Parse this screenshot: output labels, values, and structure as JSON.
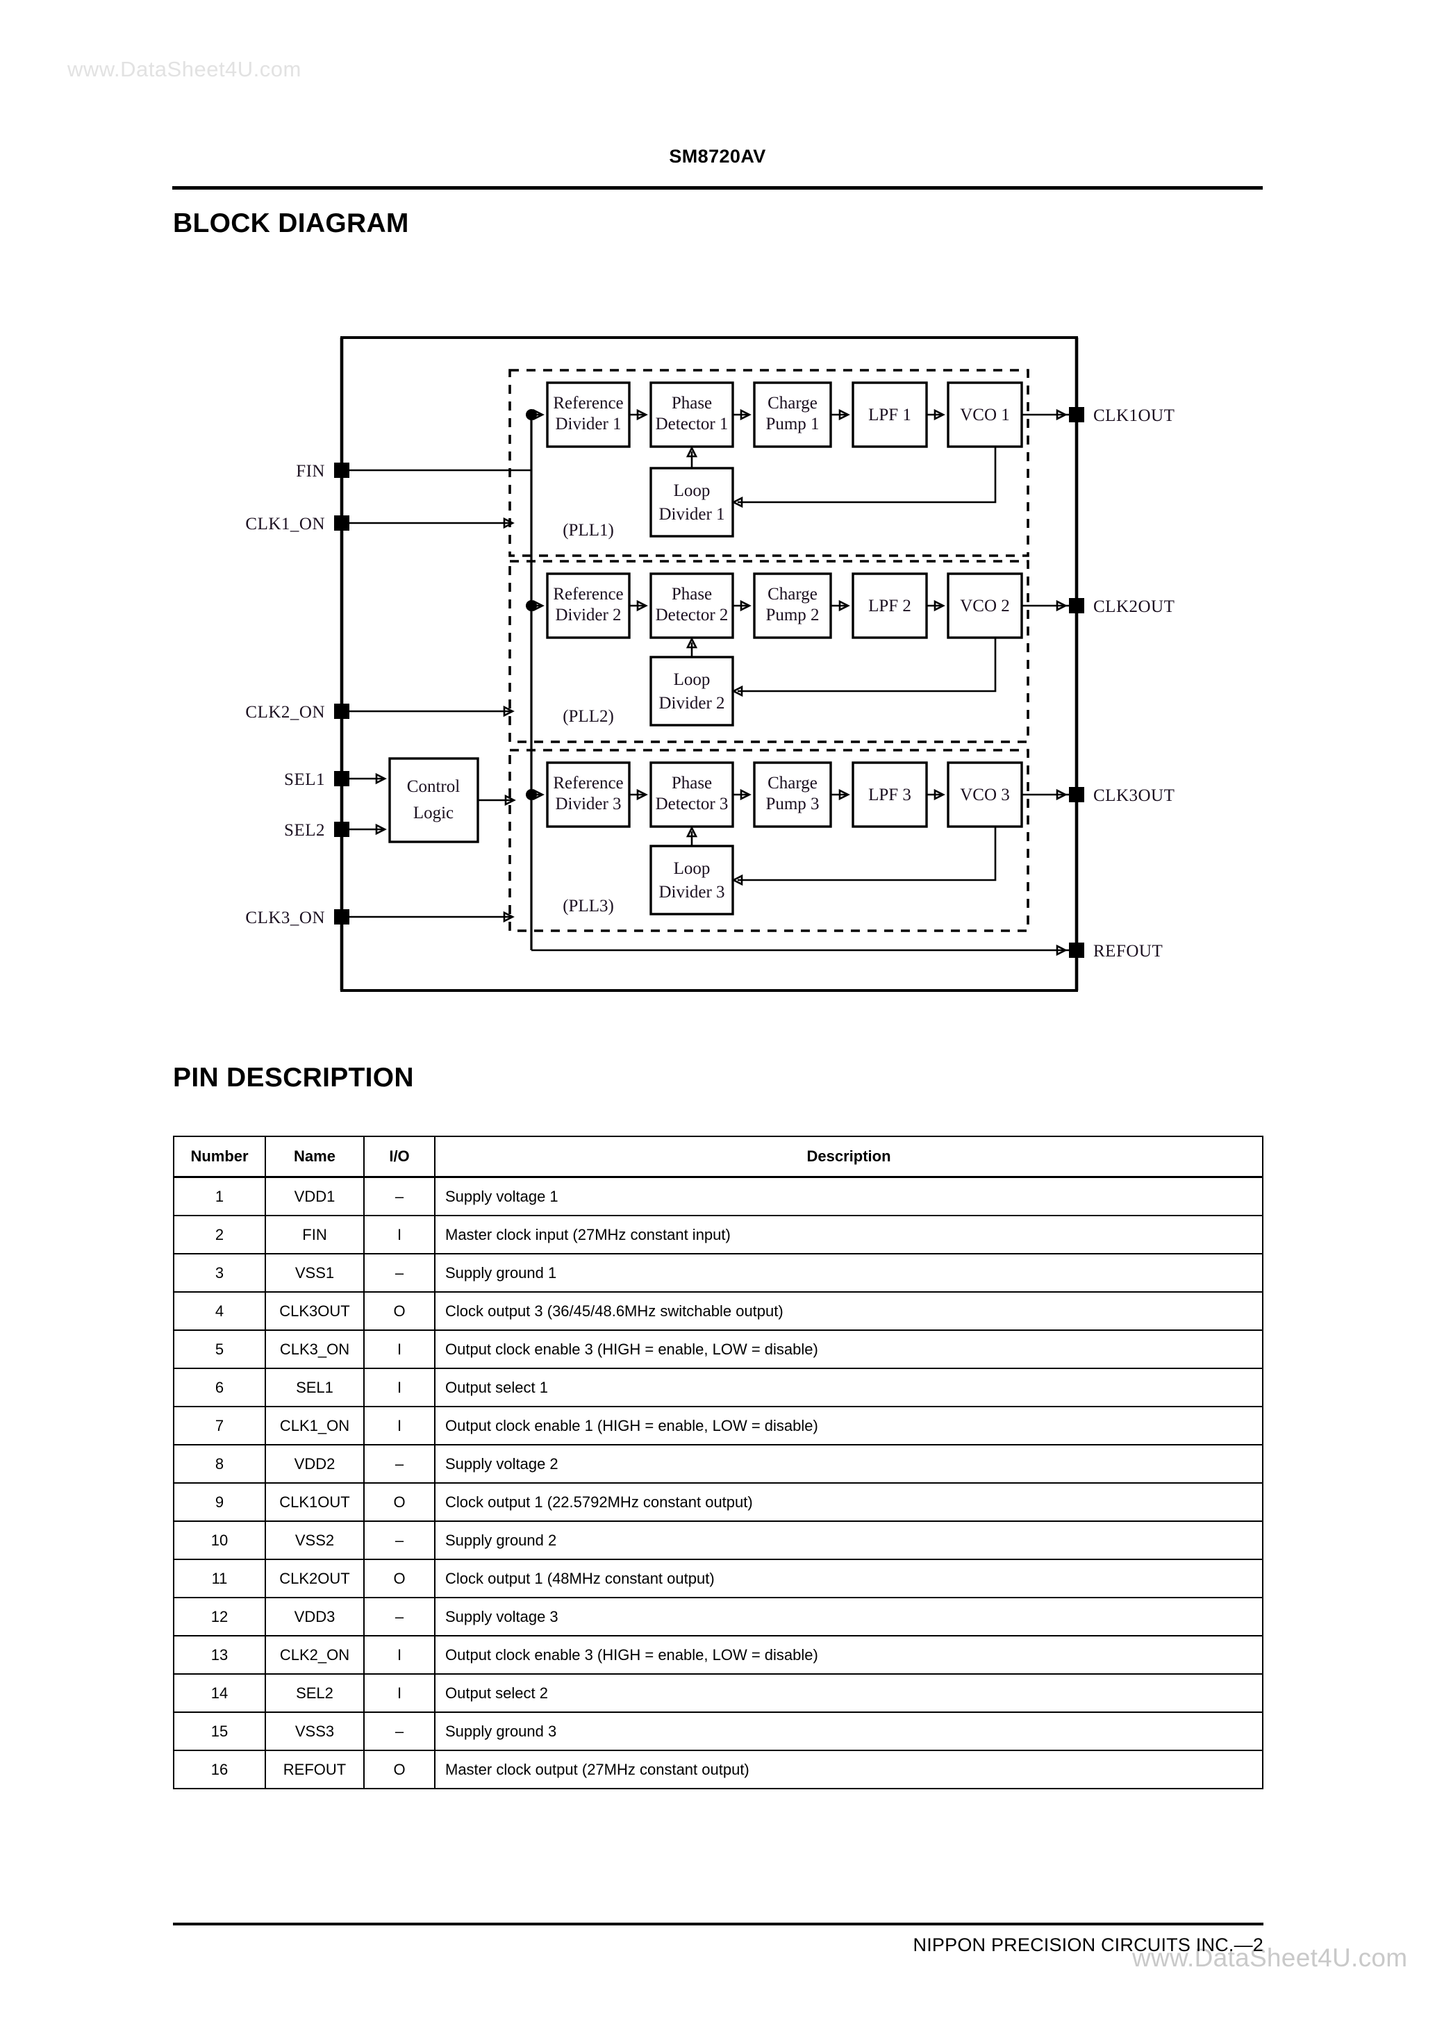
{
  "watermarks": {
    "top": "www.DataSheet4U.com",
    "bottom": "www.DataSheet4U.com"
  },
  "header": {
    "part_number": "SM8720AV"
  },
  "sections": {
    "block_diagram_heading": "BLOCK DIAGRAM",
    "pin_description_heading": "PIN DESCRIPTION"
  },
  "block_diagram": {
    "input_pins": [
      {
        "label": "FIN"
      },
      {
        "label": "CLK1_ON"
      },
      {
        "label": "CLK2_ON"
      },
      {
        "label": "SEL1"
      },
      {
        "label": "SEL2"
      },
      {
        "label": "CLK3_ON"
      }
    ],
    "output_pins": [
      {
        "label": "CLK1OUT"
      },
      {
        "label": "CLK2OUT"
      },
      {
        "label": "CLK3OUT"
      },
      {
        "label": "REFOUT"
      }
    ],
    "control_logic": {
      "line1": "Control",
      "line2": "Logic"
    },
    "plls": [
      {
        "tag": "(PLL1)",
        "blocks": [
          {
            "line1": "Reference",
            "line2": "Divider 1"
          },
          {
            "line1": "Phase",
            "line2": "Detector 1"
          },
          {
            "line1": "Charge",
            "line2": "Pump 1"
          },
          {
            "line1": "LPF 1",
            "line2": ""
          },
          {
            "line1": "VCO 1",
            "line2": ""
          }
        ],
        "loop_divider": {
          "line1": "Loop",
          "line2": "Divider 1"
        }
      },
      {
        "tag": "(PLL2)",
        "blocks": [
          {
            "line1": "Reference",
            "line2": "Divider 2"
          },
          {
            "line1": "Phase",
            "line2": "Detector 2"
          },
          {
            "line1": "Charge",
            "line2": "Pump 2"
          },
          {
            "line1": "LPF 2",
            "line2": ""
          },
          {
            "line1": "VCO 2",
            "line2": ""
          }
        ],
        "loop_divider": {
          "line1": "Loop",
          "line2": "Divider 2"
        }
      },
      {
        "tag": "(PLL3)",
        "blocks": [
          {
            "line1": "Reference",
            "line2": "Divider 3"
          },
          {
            "line1": "Phase",
            "line2": "Detector 3"
          },
          {
            "line1": "Charge",
            "line2": "Pump 3"
          },
          {
            "line1": "LPF 3",
            "line2": ""
          },
          {
            "line1": "VCO 3",
            "line2": ""
          }
        ],
        "loop_divider": {
          "line1": "Loop",
          "line2": "Divider 3"
        }
      }
    ]
  },
  "pin_table": {
    "columns": [
      "Number",
      "Name",
      "I/O",
      "Description"
    ],
    "rows": [
      {
        "number": "1",
        "name": "VDD1",
        "io": "–",
        "description": "Supply voltage 1"
      },
      {
        "number": "2",
        "name": "FIN",
        "io": "I",
        "description": "Master clock input (27MHz constant input)"
      },
      {
        "number": "3",
        "name": "VSS1",
        "io": "–",
        "description": "Supply ground 1"
      },
      {
        "number": "4",
        "name": "CLK3OUT",
        "io": "O",
        "description": "Clock output 3 (36/45/48.6MHz switchable output)"
      },
      {
        "number": "5",
        "name": "CLK3_ON",
        "io": "I",
        "description": "Output clock enable 3 (HIGH = enable, LOW = disable)"
      },
      {
        "number": "6",
        "name": "SEL1",
        "io": "I",
        "description": "Output select 1"
      },
      {
        "number": "7",
        "name": "CLK1_ON",
        "io": "I",
        "description": "Output clock enable 1 (HIGH = enable, LOW = disable)"
      },
      {
        "number": "8",
        "name": "VDD2",
        "io": "–",
        "description": "Supply voltage 2"
      },
      {
        "number": "9",
        "name": "CLK1OUT",
        "io": "O",
        "description": "Clock output 1 (22.5792MHz constant output)"
      },
      {
        "number": "10",
        "name": "VSS2",
        "io": "–",
        "description": "Supply ground 2"
      },
      {
        "number": "11",
        "name": "CLK2OUT",
        "io": "O",
        "description": "Clock output 1 (48MHz constant output)"
      },
      {
        "number": "12",
        "name": "VDD3",
        "io": "–",
        "description": "Supply voltage 3"
      },
      {
        "number": "13",
        "name": "CLK2_ON",
        "io": "I",
        "description": "Output clock enable 3 (HIGH = enable, LOW = disable)"
      },
      {
        "number": "14",
        "name": "SEL2",
        "io": "I",
        "description": "Output select 2"
      },
      {
        "number": "15",
        "name": "VSS3",
        "io": "–",
        "description": "Supply ground 3"
      },
      {
        "number": "16",
        "name": "REFOUT",
        "io": "O",
        "description": "Master clock output (27MHz constant output)"
      }
    ]
  },
  "footer": {
    "text": "NIPPON PRECISION CIRCUITS INC.—2"
  }
}
